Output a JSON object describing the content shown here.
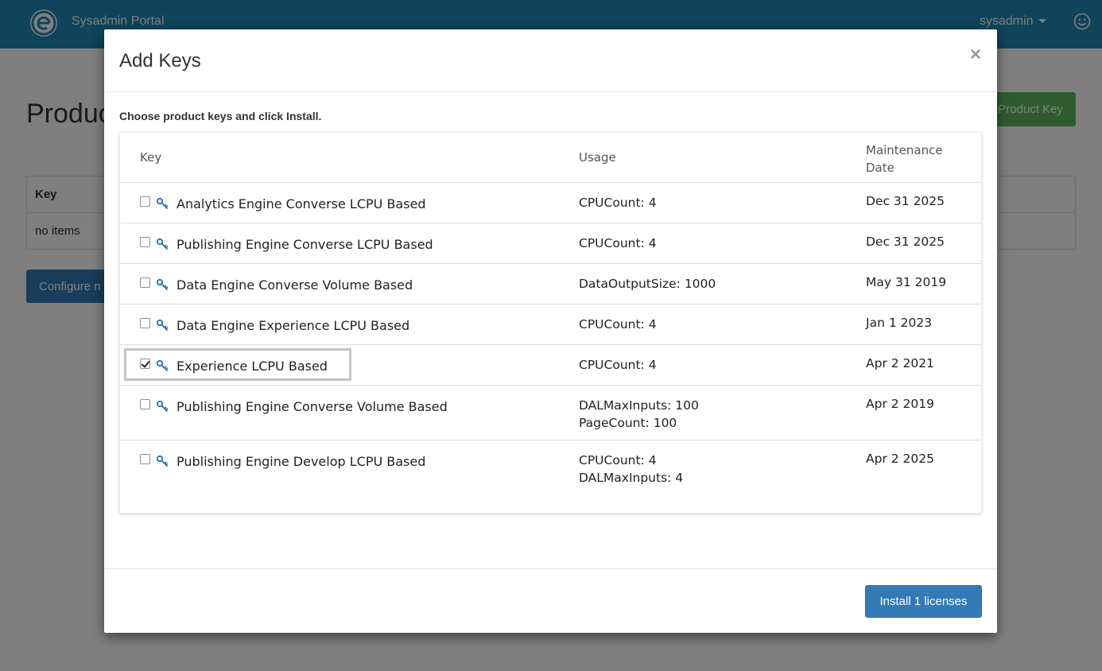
{
  "navbar": {
    "brand_name": "Sysadmin Portal",
    "user_label": "sysadmin",
    "bg_color": "#1e88b4"
  },
  "background_page": {
    "heading": "Produc",
    "add_key_button": "Product Key",
    "table_header_key": "Key",
    "table_empty": "no items",
    "configure_button": "Configure n"
  },
  "modal": {
    "title": "Add Keys",
    "close_label": "×",
    "instruction": "Choose product keys and click Install.",
    "columns": {
      "key": "Key",
      "usage": "Usage",
      "maintenance": "Maintenance Date"
    },
    "rows": [
      {
        "name": "Analytics Engine Converse LCPU Based",
        "usage": [
          "CPUCount: 4"
        ],
        "date": "Dec 31 2025",
        "checked": false
      },
      {
        "name": "Publishing Engine Converse LCPU Based",
        "usage": [
          "CPUCount: 4"
        ],
        "date": "Dec 31 2025",
        "checked": false
      },
      {
        "name": "Data Engine Converse Volume Based",
        "usage": [
          "DataOutputSize: 1000"
        ],
        "date": "May 31 2019",
        "checked": false
      },
      {
        "name": "Data Engine Experience LCPU Based",
        "usage": [
          "CPUCount: 4"
        ],
        "date": "Jan 1 2023",
        "checked": false
      },
      {
        "name": "Experience LCPU Based",
        "usage": [
          "CPUCount: 4"
        ],
        "date": "Apr 2 2021",
        "checked": true
      },
      {
        "name": "Publishing Engine Converse Volume Based",
        "usage": [
          "DALMaxInputs: 100",
          "PageCount: 100"
        ],
        "date": "Apr 2 2019",
        "checked": false
      },
      {
        "name": "Publishing Engine Develop LCPU Based",
        "usage": [
          "CPUCount: 4",
          "DALMaxInputs: 4"
        ],
        "date": "Apr 2 2025",
        "checked": false
      }
    ],
    "install_button": "Install 1 licenses",
    "accent_color": "#337ab7"
  }
}
